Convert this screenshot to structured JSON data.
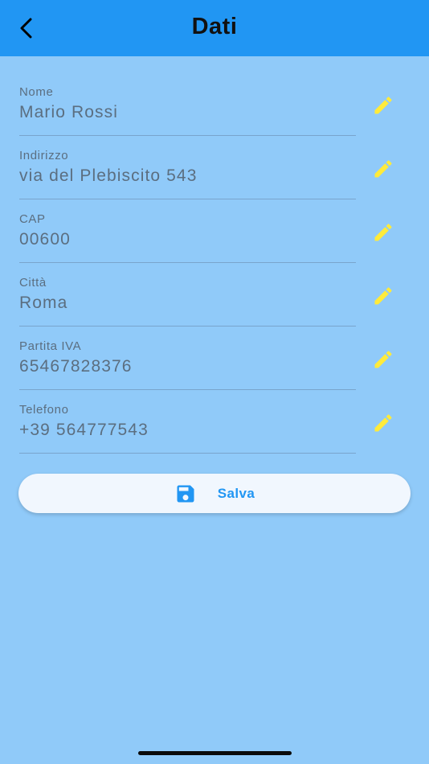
{
  "appbar": {
    "title": "Dati",
    "back_icon": "chevron-left-icon",
    "background_color": "#2196F3"
  },
  "fields": [
    {
      "id": "nome",
      "label": "Nome",
      "value": "Mario Rossi"
    },
    {
      "id": "indirizzo",
      "label": "Indirizzo",
      "value": "via del Plebiscito 543"
    },
    {
      "id": "cap",
      "label": "CAP",
      "value": "00600"
    },
    {
      "id": "citta",
      "label": "Città",
      "value": "Roma"
    },
    {
      "id": "partita-iva",
      "label": "Partita IVA",
      "value": "65467828376"
    },
    {
      "id": "telefono",
      "label": "Telefono",
      "value": "+39 564777543"
    }
  ],
  "edit_icon": "pencil-icon",
  "edit_icon_color": "#FFEB3B",
  "save_button": {
    "label": "Salva",
    "icon": "floppy-disk-icon",
    "color": "#2196F3"
  },
  "page_background": "#90CAF9"
}
